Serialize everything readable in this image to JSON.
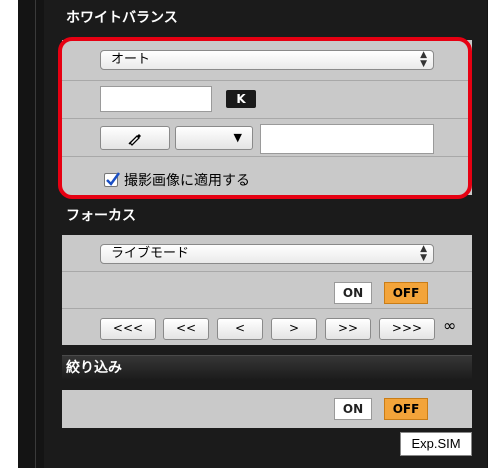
{
  "white_balance": {
    "title": "ホワイトバランス",
    "mode_selected": "オート",
    "kelvin_value": "",
    "kelvin_badge": "K",
    "picker_dropdown_value": "",
    "picker_dropdown_arrow": "▼",
    "picker_field_value": "",
    "apply_checkbox_checked": true,
    "apply_label": "撮影画像に適用する"
  },
  "focus": {
    "title": "フォーカス",
    "mode_selected": "ライブモード",
    "on_label": "ON",
    "off_label": "OFF",
    "steps": [
      "<<<",
      "<<",
      "<",
      ">",
      ">>",
      ">>>"
    ],
    "infinity_label": "∞"
  },
  "aperture": {
    "title": "絞り込み",
    "on_label": "ON",
    "off_label": "OFF"
  },
  "exp_sim_label": "Exp.SIM",
  "colors": {
    "highlight": "#e60012",
    "off_active": "#f3a43a",
    "panel_bg": "#c9c9c9"
  }
}
